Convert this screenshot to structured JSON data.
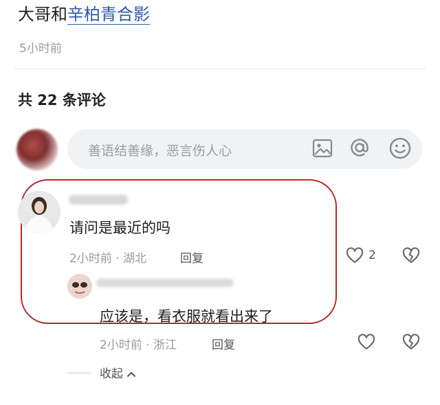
{
  "post": {
    "title_prefix": "大哥和",
    "title_link": "辛柏青合影",
    "time": "5小时前"
  },
  "comments_header": {
    "count_text": "共 22 条评论"
  },
  "comment_input": {
    "placeholder": "善语结善缘，恶言伤人心",
    "icons": [
      "image-icon",
      "at-icon",
      "emoji-icon"
    ]
  },
  "comments": [
    {
      "text": "请问是最近的吗",
      "meta": "2小时前 · 湖北",
      "reply_label": "回复",
      "like_count": "2",
      "replies": [
        {
          "text": "应该是，看衣服就看出来了",
          "meta": "2小时前 · 浙江",
          "reply_label": "回复"
        }
      ]
    }
  ],
  "collapse_label": "收起",
  "colors": {
    "link": "#2d5aa8",
    "highlight": "#b22a2a",
    "muted": "#9a9a9a"
  }
}
